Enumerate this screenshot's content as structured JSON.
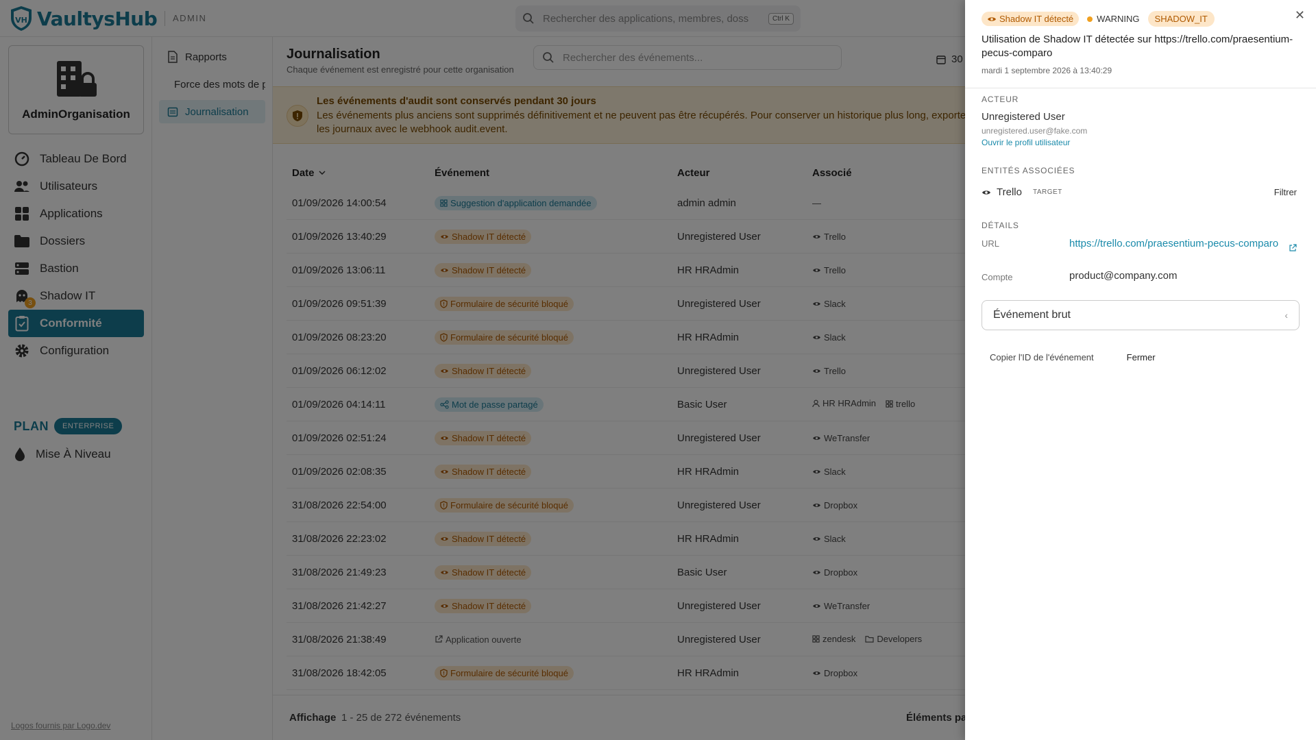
{
  "app": {
    "brand": "VaultysHub",
    "section": "ADMIN",
    "search_placeholder": "Rechercher des applications, membres, dossiers...",
    "search_shortcut": "Ctrl K",
    "accent_color": "#1a7a96"
  },
  "sidebar": {
    "org_name": "AdminOrganisation",
    "items": [
      {
        "label": "Tableau De Bord",
        "icon": "dashboard-icon"
      },
      {
        "label": "Utilisateurs",
        "icon": "users-icon"
      },
      {
        "label": "Applications",
        "icon": "apps-icon"
      },
      {
        "label": "Dossiers",
        "icon": "folder-icon"
      },
      {
        "label": "Bastion",
        "icon": "server-icon"
      },
      {
        "label": "Shadow IT",
        "icon": "ghost-icon",
        "badge": "3"
      },
      {
        "label": "Conformité",
        "icon": "clipboard-check-icon",
        "active": true
      },
      {
        "label": "Configuration",
        "icon": "gear-icon"
      }
    ],
    "plan_label": "PLAN",
    "plan_badge": "ENTERPRISE",
    "upgrade_label": "Mise À Niveau",
    "logo_credit": "Logos fournis par Logo.dev"
  },
  "subnav": {
    "items": [
      {
        "label": "Rapports"
      },
      {
        "label": "Force des mots de passe"
      },
      {
        "label": "Journalisation",
        "active": true
      }
    ]
  },
  "main": {
    "title": "Journalisation",
    "subtitle": "Chaque événement est enregistré pour cette organisation",
    "search_placeholder": "Rechercher des événements...",
    "date_range": "30",
    "warning": {
      "title": "Les événements d'audit sont conservés pendant 30 jours",
      "text": "Les événements plus anciens sont supprimés définitivement et ne peuvent pas être récupérés. Pour conserver un historique plus long, exportez les journaux avec le webhook audit.event."
    },
    "columns": {
      "date": "Date",
      "event": "Événement",
      "actor": "Acteur",
      "assoc": "Associé"
    },
    "rows": [
      {
        "date": "01/09/2026 14:00:54",
        "event": "Suggestion d'application demandée",
        "kind": "blue",
        "icon": "apps",
        "actor": "admin admin",
        "assoc": [
          {
            "label": "—",
            "icon": ""
          }
        ]
      },
      {
        "date": "01/09/2026 13:40:29",
        "event": "Shadow IT détecté",
        "kind": "orange",
        "icon": "eye",
        "actor": "Unregistered User",
        "assoc": [
          {
            "label": "Trello",
            "icon": "eye"
          }
        ]
      },
      {
        "date": "01/09/2026 13:06:11",
        "event": "Shadow IT détecté",
        "kind": "orange",
        "icon": "eye",
        "actor": "HR HRAdmin",
        "assoc": [
          {
            "label": "Trello",
            "icon": "eye"
          }
        ]
      },
      {
        "date": "01/09/2026 09:51:39",
        "event": "Formulaire de sécurité bloqué",
        "kind": "orange",
        "icon": "shield",
        "actor": "Unregistered User",
        "assoc": [
          {
            "label": "Slack",
            "icon": "eye"
          }
        ]
      },
      {
        "date": "01/09/2026 08:23:20",
        "event": "Formulaire de sécurité bloqué",
        "kind": "orange",
        "icon": "shield",
        "actor": "HR HRAdmin",
        "assoc": [
          {
            "label": "Slack",
            "icon": "eye"
          }
        ]
      },
      {
        "date": "01/09/2026 06:12:02",
        "event": "Shadow IT détecté",
        "kind": "orange",
        "icon": "eye",
        "actor": "Unregistered User",
        "assoc": [
          {
            "label": "Trello",
            "icon": "eye"
          }
        ]
      },
      {
        "date": "01/09/2026 04:14:11",
        "event": "Mot de passe partagé",
        "kind": "blue",
        "icon": "share",
        "actor": "Basic User",
        "assoc": [
          {
            "label": "HR HRAdmin",
            "icon": "user"
          },
          {
            "label": "trello",
            "icon": "apps"
          }
        ]
      },
      {
        "date": "01/09/2026 02:51:24",
        "event": "Shadow IT détecté",
        "kind": "orange",
        "icon": "eye",
        "actor": "Unregistered User",
        "assoc": [
          {
            "label": "WeTransfer",
            "icon": "eye"
          }
        ]
      },
      {
        "date": "01/09/2026 02:08:35",
        "event": "Shadow IT détecté",
        "kind": "orange",
        "icon": "eye",
        "actor": "HR HRAdmin",
        "assoc": [
          {
            "label": "Slack",
            "icon": "eye"
          }
        ]
      },
      {
        "date": "31/08/2026 22:54:00",
        "event": "Formulaire de sécurité bloqué",
        "kind": "orange",
        "icon": "shield",
        "actor": "Unregistered User",
        "assoc": [
          {
            "label": "Dropbox",
            "icon": "eye"
          }
        ]
      },
      {
        "date": "31/08/2026 22:23:02",
        "event": "Shadow IT détecté",
        "kind": "orange",
        "icon": "eye",
        "actor": "HR HRAdmin",
        "assoc": [
          {
            "label": "Slack",
            "icon": "eye"
          }
        ]
      },
      {
        "date": "31/08/2026 21:49:23",
        "event": "Shadow IT détecté",
        "kind": "orange",
        "icon": "eye",
        "actor": "Basic User",
        "assoc": [
          {
            "label": "Dropbox",
            "icon": "eye"
          }
        ]
      },
      {
        "date": "31/08/2026 21:42:27",
        "event": "Shadow IT détecté",
        "kind": "orange",
        "icon": "eye",
        "actor": "Unregistered User",
        "assoc": [
          {
            "label": "WeTransfer",
            "icon": "eye"
          }
        ]
      },
      {
        "date": "31/08/2026 21:38:49",
        "event": "Application ouverte",
        "kind": "plain",
        "icon": "external",
        "actor": "Unregistered User",
        "assoc": [
          {
            "label": "zendesk",
            "icon": "apps"
          },
          {
            "label": "Developers",
            "icon": "folder"
          }
        ]
      },
      {
        "date": "31/08/2026 18:42:05",
        "event": "Formulaire de sécurité bloqué",
        "kind": "orange",
        "icon": "shield",
        "actor": "HR HRAdmin",
        "assoc": [
          {
            "label": "Dropbox",
            "icon": "eye"
          }
        ]
      }
    ],
    "footer": {
      "display_label": "Affichage",
      "range": "1 - 25 de 272  événements",
      "per_page_label": "Éléments par page"
    }
  },
  "drawer": {
    "event_badge": "Shadow IT détecté",
    "severity": "WARNING",
    "code": "SHADOW_IT",
    "title": "Utilisation de Shadow IT détectée sur https://trello.com/praesentium-pecus-comparo",
    "date": "mardi 1 septembre 2026 à 13:40:29",
    "actor_label": "ACTEUR",
    "actor_name": "Unregistered User",
    "actor_email": "unregistered.user@fake.com",
    "actor_link": "Ouvrir le profil utilisateur",
    "entities_label": "ENTITÉS ASSOCIÉES",
    "entity_name": "Trello",
    "entity_tag": "TARGET",
    "entity_filter": "Filtrer",
    "details_label": "DÉTAILS",
    "url_key": "URL",
    "url_value": "https://trello.com/praesentium-pecus-comparo",
    "account_key": "Compte",
    "account_value": "product@company.com",
    "raw_label": "Événement brut",
    "copy_id": "Copier l'ID de l'événement",
    "close": "Fermer"
  }
}
